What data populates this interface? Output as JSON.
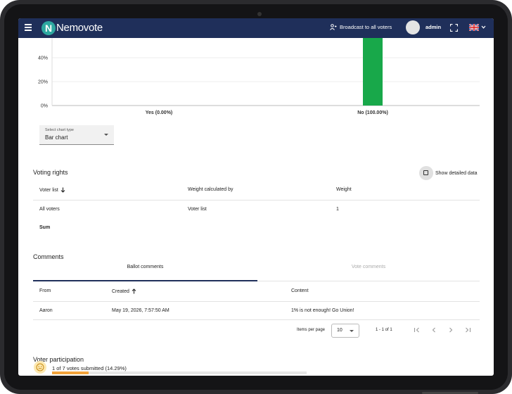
{
  "appbar": {
    "logo_text": "Nemovote",
    "logo_letter": "N",
    "broadcast_label": "Broadcast to all voters",
    "user_label": "admin"
  },
  "chart_data": {
    "type": "bar",
    "categories": [
      "Yes (0.00%)",
      "No (100.00%)"
    ],
    "values": [
      0,
      100
    ],
    "y_ticks_visible": [
      "40%",
      "20%",
      "0%"
    ],
    "bar_color": "#18a84a",
    "grid": true
  },
  "chart_type_select": {
    "label": "Select chart type",
    "value": "Bar chart"
  },
  "voting_rights": {
    "title": "Voting rights",
    "detail_toggle_label": "Show detailed data",
    "columns": [
      "Voter list",
      "Weight calculated by",
      "Weight"
    ],
    "rows": [
      [
        "All voters",
        "Voter list",
        "1"
      ]
    ],
    "sum_label": "Sum"
  },
  "comments": {
    "title": "Comments",
    "tabs": [
      "Ballot comments",
      "Vote comments"
    ],
    "columns": [
      "From",
      "Created",
      "Content"
    ],
    "rows": [
      [
        "Aaron",
        "May 19, 2026, 7:57:50 AM",
        "1% is not enough! Go Union!"
      ]
    ],
    "items_per_page_label": "Items per page",
    "items_per_page_value": "10",
    "range_label": "1 - 1 of 1"
  },
  "participation": {
    "title": "Voter participation",
    "summary": "1 of 7 votes submitted (14.29%)",
    "progress_fraction": 0.1429
  }
}
